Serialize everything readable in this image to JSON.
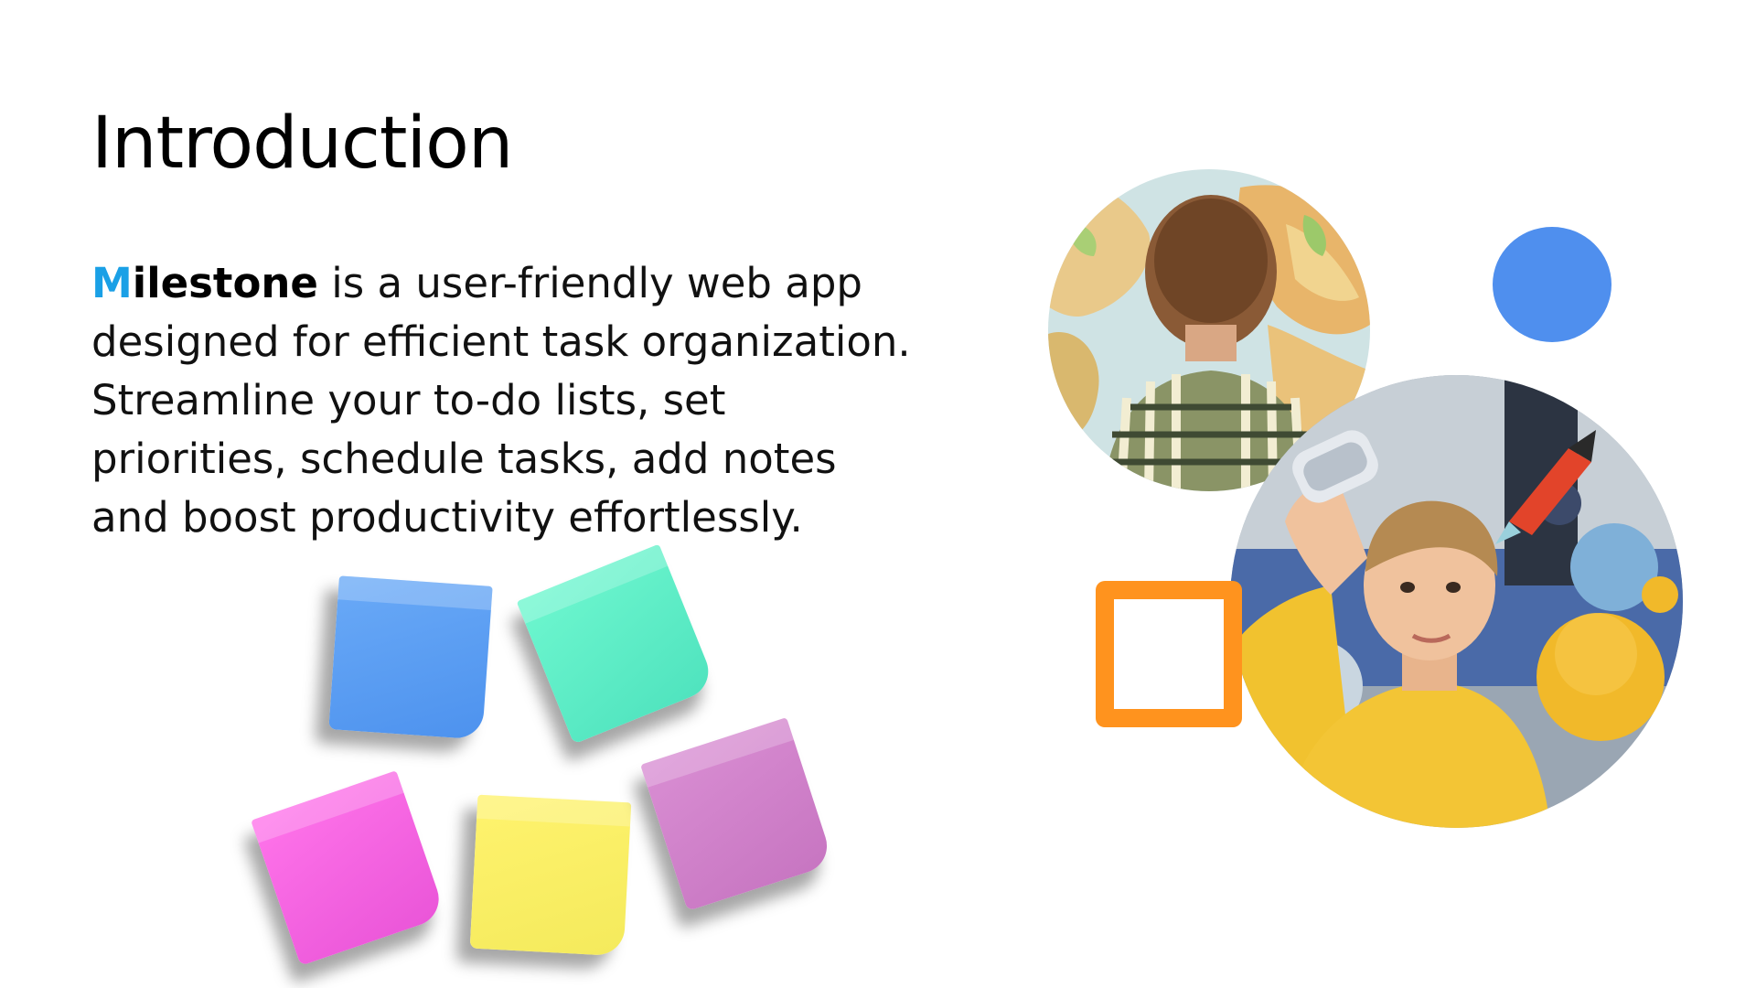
{
  "slide": {
    "title": "Introduction",
    "body": {
      "brand_initial": "M",
      "brand_rest": "ilestone",
      "text": " is a user-friendly web app designed for efficient task organization. Streamline your to-do lists, set priorities, schedule tasks, add notes and boost productivity effortlessly."
    }
  },
  "colors": {
    "brand_initial": "#1aa0e6",
    "note_blue": "#5a9ef2",
    "note_green": "#5ef0c8",
    "note_pink": "#f462e2",
    "note_yellow": "#f9ef62",
    "note_purple": "#d084cb",
    "deco_dot": "#4f8fee",
    "deco_square": "#ff931e"
  },
  "images": {
    "photo_1": "boy-looking-at-world-map",
    "photo_2": "boy-holding-space-shuttle-toy-with-planets"
  }
}
